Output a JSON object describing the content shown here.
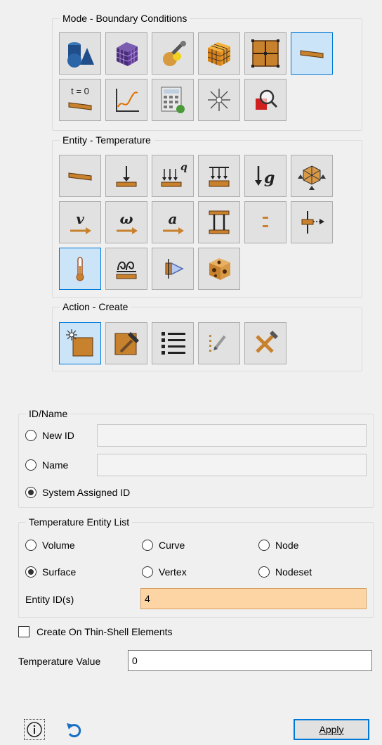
{
  "mode_group": {
    "title": "Mode - Boundary Conditions",
    "row1": [
      {
        "name": "geometry-mode-button",
        "icon": "geometry-icon"
      },
      {
        "name": "mesh-mode-button",
        "icon": "mesh-cube-icon"
      },
      {
        "name": "tools-mode-button",
        "icon": "wrench-icon"
      },
      {
        "name": "hex-mesh-button",
        "icon": "hex-cube-icon"
      },
      {
        "name": "grid-mode-button",
        "icon": "grid-icon"
      },
      {
        "name": "boundary-conditions-button",
        "icon": "plate-icon",
        "selected": true
      }
    ],
    "row2": [
      {
        "name": "time-step-button",
        "icon": "time-plate-icon",
        "label": "t = 0"
      },
      {
        "name": "graph-mode-button",
        "icon": "graph-icon"
      },
      {
        "name": "calculator-button",
        "icon": "calculator-icon"
      },
      {
        "name": "sparkle-button",
        "icon": "sparkle-icon"
      },
      {
        "name": "inspect-button",
        "icon": "magnifier-icon"
      }
    ]
  },
  "entity_group": {
    "title": "Entity - Temperature",
    "rows": [
      [
        {
          "name": "entity-plate-button",
          "icon": "plate-icon"
        },
        {
          "name": "entity-force-button",
          "icon": "force-arrow-icon"
        },
        {
          "name": "entity-heatflux-button",
          "icon": "heat-flux-icon",
          "label": "q"
        },
        {
          "name": "entity-pressure-button",
          "icon": "pressure-icon"
        },
        {
          "name": "entity-gravity-button",
          "icon": "gravity-icon",
          "label": "g"
        },
        {
          "name": "entity-constraint-button",
          "icon": "constraint-icon"
        }
      ],
      [
        {
          "name": "entity-velocity-button",
          "icon": "velocity-icon",
          "label": "v"
        },
        {
          "name": "entity-angular-velocity-button",
          "icon": "angular-velocity-icon",
          "label": "ω"
        },
        {
          "name": "entity-acceleration-button",
          "icon": "acceleration-icon",
          "label": "a"
        },
        {
          "name": "entity-column-button",
          "icon": "column-icon"
        },
        {
          "name": "entity-dashes-button",
          "icon": "dashes-icon"
        },
        {
          "name": "entity-arrow-right-button",
          "icon": "arrow-right-icon"
        }
      ],
      [
        {
          "name": "entity-temperature-button",
          "icon": "thermometer-icon",
          "selected": true
        },
        {
          "name": "entity-convection-button",
          "icon": "convection-icon"
        },
        {
          "name": "entity-radiation-button",
          "icon": "radiation-icon"
        },
        {
          "name": "entity-cheese-button",
          "icon": "cheese-block-icon"
        }
      ]
    ]
  },
  "action_group": {
    "title": "Action - Create",
    "buttons": [
      {
        "name": "action-create-button",
        "icon": "create-sparkle-icon",
        "selected": true
      },
      {
        "name": "action-modify-button",
        "icon": "hammer-icon"
      },
      {
        "name": "action-list-button",
        "icon": "list-icon"
      },
      {
        "name": "action-edit-list-button",
        "icon": "edit-list-icon"
      },
      {
        "name": "action-delete-button",
        "icon": "delete-tools-icon"
      }
    ]
  },
  "id_group": {
    "title": "ID/Name",
    "new_id_label": "New ID",
    "name_label": "Name",
    "system_label": "System Assigned ID",
    "new_id_value": "",
    "name_value": ""
  },
  "entity_list_group": {
    "title": "Temperature Entity List",
    "volume": "Volume",
    "curve": "Curve",
    "node": "Node",
    "surface": "Surface",
    "vertex": "Vertex",
    "nodeset": "Nodeset",
    "entity_ids_label": "Entity ID(s)",
    "entity_ids_value": "4"
  },
  "thin_shell_label": "Create On Thin-Shell Elements",
  "temperature_value_label": "Temperature Value",
  "temperature_value": "0",
  "apply_label": "Apply",
  "colors": {
    "accent": "#0078d7",
    "highlight_field": "#fdd5a4",
    "copper": "#c8812c"
  }
}
